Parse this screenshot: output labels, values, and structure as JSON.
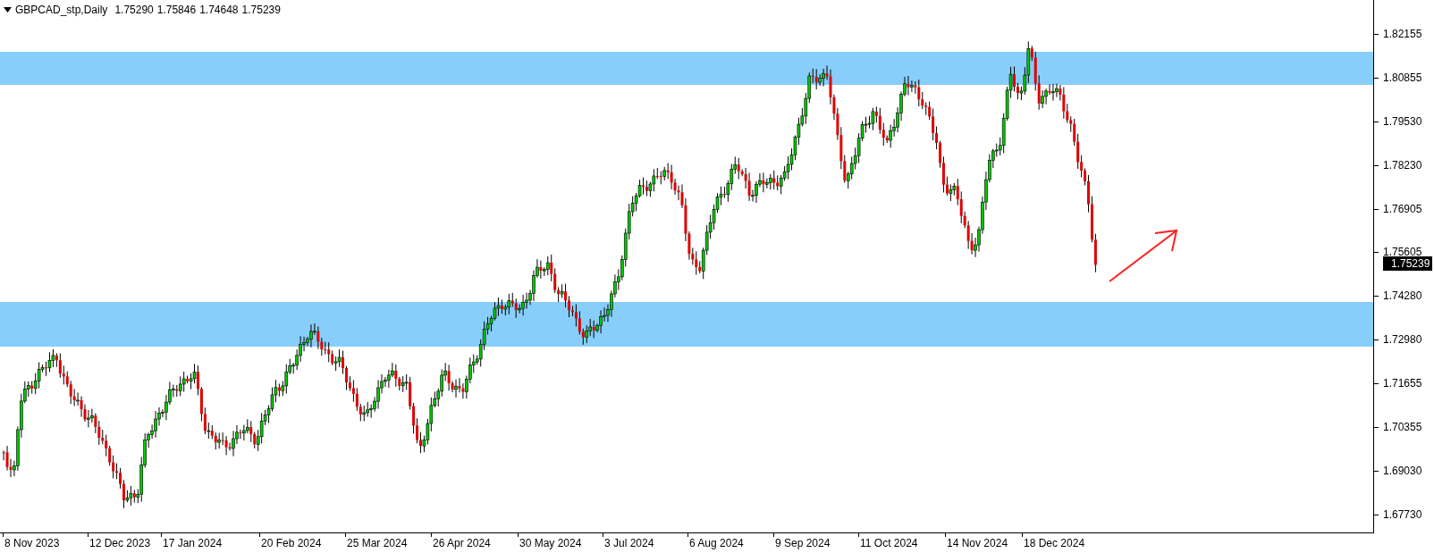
{
  "header": {
    "symbol": "GBPCAD_stp,Daily",
    "ohlc": [
      "1.75290",
      "1.75846",
      "1.74648",
      "1.75239"
    ]
  },
  "price_axis": {
    "labels": [
      "1.82155",
      "1.80855",
      "1.79530",
      "1.78230",
      "1.76905",
      "1.75605",
      "1.74280",
      "1.72980",
      "1.71655",
      "1.70355",
      "1.69030",
      "1.67730"
    ],
    "current_price": "1.75239"
  },
  "time_axis": {
    "labels": [
      "8 Nov 2023",
      "12 Dec 2023",
      "17 Jan 2024",
      "20 Feb 2024",
      "25 Mar 2024",
      "26 Apr 2024",
      "30 May 2024",
      "3 Jul 2024",
      "6 Aug 2024",
      "9 Sep 2024",
      "11 Oct 2024",
      "14 Nov 2024",
      "18 Dec 2024"
    ]
  }
}
